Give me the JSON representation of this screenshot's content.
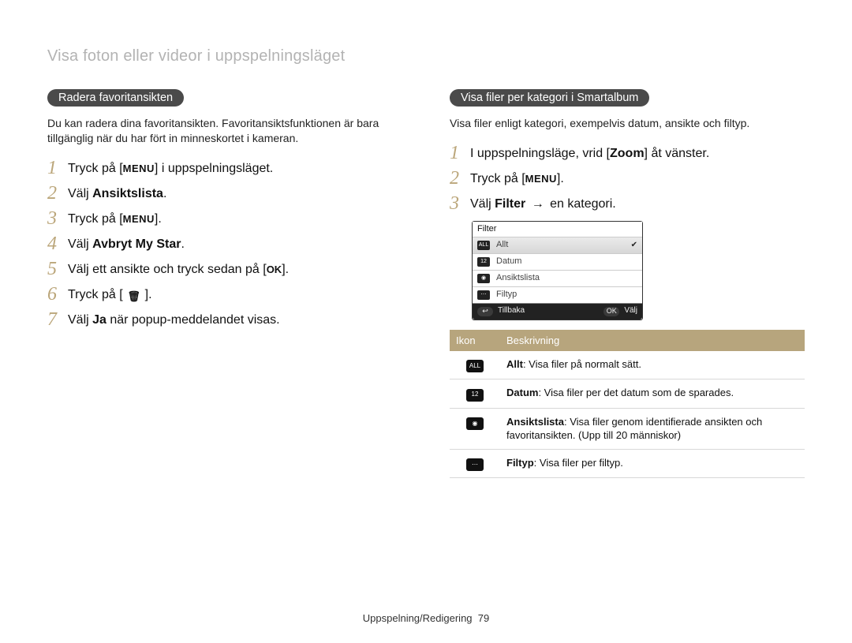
{
  "page_title": "Visa foton eller videor i uppspelningsläget",
  "left": {
    "pill": "Radera favoritansikten",
    "intro": "Du kan radera dina favoritansikten. Favoritansiktsfunktionen är bara tillgänglig när du har fört in minneskortet i kameran.",
    "steps": {
      "s1a": "Tryck på [",
      "s1_menu": "MENU",
      "s1b": "] i uppspelningsläget.",
      "s2a": "Välj ",
      "s2b": "Ansiktslista",
      "s2c": ".",
      "s3a": "Tryck på [",
      "s3_menu": "MENU",
      "s3b": "].",
      "s4a": "Välj ",
      "s4b": "Avbryt My Star",
      "s4c": ".",
      "s5a": "Välj ett ansikte och tryck sedan på [",
      "s5_ok": "OK",
      "s5b": "].",
      "s6a": "Tryck på [",
      "s6b": "].",
      "s7a": "Välj ",
      "s7_ja": "Ja",
      "s7b": " när popup-meddelandet visas."
    }
  },
  "right": {
    "pill": "Visa filer per kategori i Smartalbum",
    "intro": "Visa filer enligt kategori, exempelvis datum, ansikte och filtyp.",
    "steps": {
      "s1a": "I uppspelningsläge, vrid [",
      "s1_zoom": "Zoom",
      "s1b": "] åt vänster.",
      "s2a": "Tryck på [",
      "s2_menu": "MENU",
      "s2b": "].",
      "s3a": "Välj ",
      "s3_filter": "Filter",
      "s3_arrow": " → ",
      "s3b": "en kategori."
    },
    "cam": {
      "title": "Filter",
      "r1": "Allt",
      "r2": "Datum",
      "r3": "Ansiktslista",
      "r4": "Filtyp",
      "back": "Tillbaka",
      "select": "Välj",
      "ok": "OK"
    },
    "table": {
      "h1": "Ikon",
      "h2": "Beskrivning",
      "r1b": "Allt",
      "r1c": ": Visa filer på normalt sätt.",
      "r2b": "Datum",
      "r2c": ": Visa filer per det datum som de sparades.",
      "r3b": "Ansiktslista",
      "r3c": ": Visa filer genom identifierade ansikten och favoritansikten. (Upp till 20 människor)",
      "r4b": "Filtyp",
      "r4c": ": Visa filer per filtyp."
    }
  },
  "footer": {
    "section": "Uppspelning/Redigering",
    "page_no": "79"
  },
  "icons": {
    "all": "ALL",
    "cal": "12",
    "face": "◉",
    "film": "⋯",
    "back": "↩",
    "menu_word": "MENU"
  }
}
